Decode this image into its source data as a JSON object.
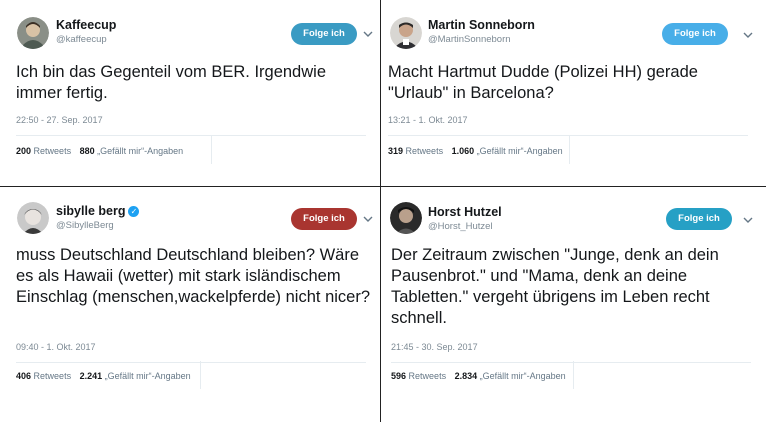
{
  "tweets": [
    {
      "name": "Kaffeecup",
      "handle": "@kaffeecup",
      "follow_label": "Folge ich",
      "follow_color": "#3a9bc3",
      "text": "Ich bin das Gegenteil vom BER. Irgendwie immer fertig.",
      "timestamp": "22:50 - 27. Sep. 2017",
      "retweets": "200",
      "retweets_label": "Retweets",
      "likes": "880",
      "likes_label": "„Gefällt mir“-Angaben"
    },
    {
      "name": "Martin Sonneborn",
      "handle": "@MartinSonneborn",
      "follow_label": "Folge ich",
      "follow_color": "#48aee8",
      "text": "Macht Hartmut Dudde (Polizei HH) gerade \"Urlaub\" in Barcelona?",
      "timestamp": "13:21 - 1. Okt. 2017",
      "retweets": "319",
      "retweets_label": "Retweets",
      "likes": "1.060",
      "likes_label": "„Gefällt mir“-Angaben"
    },
    {
      "name": "sibylle berg",
      "handle": "@SibylleBerg",
      "follow_label": "Folge ich",
      "follow_color": "#a93530",
      "text": "muss Deutschland Deutschland bleiben? Wäre es  als Hawaii (wetter) mit stark isländischem Einschlag (menschen,wackelpferde) nicht nicer?",
      "timestamp": "09:40 - 1. Okt. 2017",
      "retweets": "406",
      "retweets_label": "Retweets",
      "likes": "2.241",
      "likes_label": "„Gefällt mir“-Angaben"
    },
    {
      "name": "Horst Hutzel",
      "handle": "@Horst_Hutzel",
      "follow_label": "Folge ich",
      "follow_color": "#26a0c5",
      "text": "Der Zeitraum zwischen \"Junge, denk an dein Pausenbrot.\" und \"Mama, denk an deine Tabletten.\" vergeht übrigens im Leben recht schnell.",
      "timestamp": "21:45 - 30. Sep. 2017",
      "retweets": "596",
      "retweets_label": "Retweets",
      "likes": "2.834",
      "likes_label": "„Gefällt mir“-Angaben"
    }
  ],
  "icons": {
    "verified": "verified-badge-icon",
    "chevron": "chevron-down-icon"
  }
}
